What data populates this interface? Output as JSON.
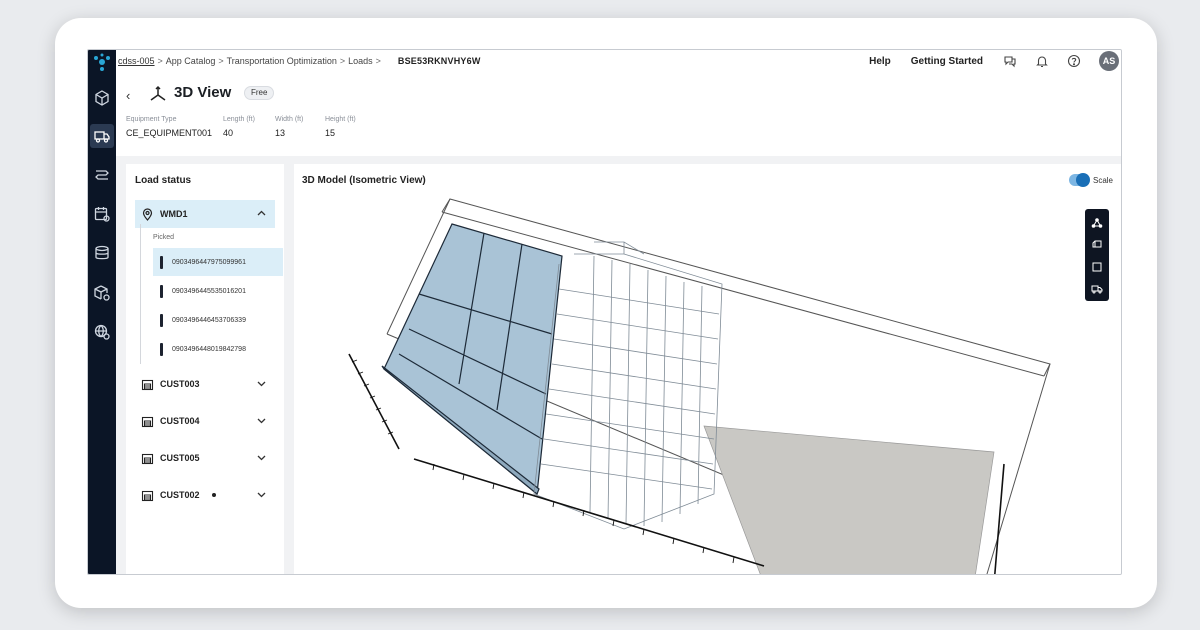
{
  "breadcrumb": {
    "home": "cdss-005",
    "items": [
      "App Catalog",
      "Transportation Optimization",
      "Loads"
    ],
    "current_id": "BSE53RKNVHY6W"
  },
  "topbar": {
    "help": "Help",
    "getting_started": "Getting Started",
    "avatar_initials": "AS"
  },
  "rail": {
    "icons": [
      "cube-icon",
      "truck-icon",
      "route-icon",
      "calendar-settings-icon",
      "database-icon",
      "box-settings-icon",
      "globe-settings-icon"
    ]
  },
  "header": {
    "title": "3D View",
    "badge": "Free",
    "fields": [
      {
        "label": "Equipment Type",
        "value": "CE_EQUIPMENT001"
      },
      {
        "label": "Length (ft)",
        "value": "40"
      },
      {
        "label": "Width (ft)",
        "value": "13"
      },
      {
        "label": "Height (ft)",
        "value": "15"
      }
    ]
  },
  "load_status": {
    "title": "Load status",
    "groups": [
      {
        "label": "WMD1",
        "expanded": true,
        "sub_label": "Picked",
        "items": [
          "0903496447975099961",
          "0903496445535016201",
          "0903496446453706339",
          "0903496448019842798"
        ]
      },
      {
        "label": "CUST003",
        "expanded": false
      },
      {
        "label": "CUST004",
        "expanded": false
      },
      {
        "label": "CUST005",
        "expanded": false
      },
      {
        "label": "CUST002",
        "expanded": false
      }
    ]
  },
  "model_panel": {
    "title": "3D Model (Isometric View)",
    "scale_label": "Scale",
    "scale_on": true
  },
  "colors": {
    "rail_bg": "#0b1526",
    "selection": "#dbeef8",
    "toggle_accent": "#1a6fb7",
    "solid_box_fill": "#a9c3d6",
    "floor_fill": "#c9c8c4"
  }
}
